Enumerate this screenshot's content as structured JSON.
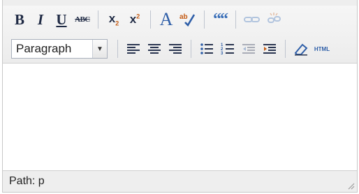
{
  "toolbar": {
    "row1": {
      "bold": "B",
      "italic": "I",
      "underline": "U",
      "strikethrough": "ABC",
      "subscript_x": "x",
      "subscript_mark": "2",
      "superscript_x": "x",
      "superscript_mark": "2",
      "font_color": "A",
      "blockquote": "““"
    },
    "row2": {
      "block_format": "Paragraph",
      "html_label": "HTML"
    }
  },
  "icons": {
    "bold": "bold-icon",
    "italic": "italic-icon",
    "underline": "underline-icon",
    "strikethrough": "strikethrough-icon",
    "subscript": "subscript-icon",
    "superscript": "superscript-icon",
    "font_color": "font-color-icon",
    "spellcheck": "spellcheck-icon",
    "blockquote": "blockquote-icon",
    "link": "link-icon",
    "unlink": "unlink-icon",
    "align_left": "align-left-icon",
    "align_center": "align-center-icon",
    "align_right": "align-right-icon",
    "bullet_list": "bullet-list-icon",
    "numbered_list": "numbered-list-icon",
    "outdent": "outdent-icon",
    "indent": "indent-icon",
    "remove_format": "eraser-icon",
    "html_source": "html-icon"
  },
  "colors": {
    "icon_dark": "#1f2a44",
    "icon_blue": "#2e5ea8",
    "accent_orange": "#c45b14"
  },
  "statusbar": {
    "path": "Path: p"
  }
}
